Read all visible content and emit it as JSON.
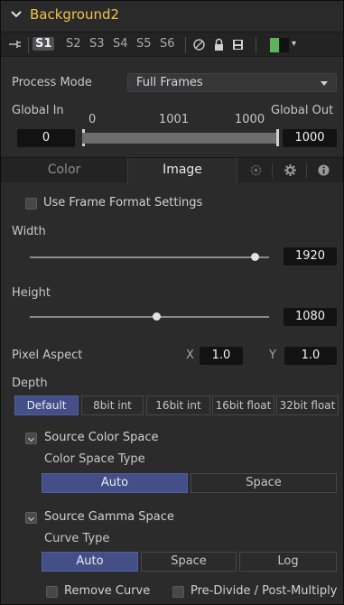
{
  "header": {
    "title": "Background2"
  },
  "toolbar": {
    "slots": [
      "S1",
      "S2",
      "S3",
      "S4",
      "S5",
      "S6"
    ],
    "active_slot": "S1",
    "swatch_colors": [
      "#5bb35b",
      "#111111"
    ]
  },
  "process_mode": {
    "label": "Process Mode",
    "value": "Full Frames"
  },
  "global": {
    "in_label": "Global In",
    "out_label": "Global Out",
    "range_min": "0",
    "range_mid": "1001",
    "range_max": "1000",
    "in_value": "0",
    "out_value": "1000"
  },
  "tabs": [
    {
      "label": "Color",
      "active": false
    },
    {
      "label": "Image",
      "active": true
    }
  ],
  "frame_format": {
    "label": "Use Frame Format Settings",
    "checked": false
  },
  "width": {
    "label": "Width",
    "value": "1920",
    "fraction": 0.94
  },
  "height": {
    "label": "Height",
    "value": "1080",
    "fraction": 0.53
  },
  "pixel_aspect": {
    "label": "Pixel Aspect",
    "x_label": "X",
    "x_value": "1.0",
    "y_label": "Y",
    "y_value": "1.0"
  },
  "depth": {
    "label": "Depth",
    "options": [
      "Default",
      "8bit int",
      "16bit int",
      "16bit float",
      "32bit float"
    ],
    "selected": "Default"
  },
  "source_color_space": {
    "section_label": "Source Color Space",
    "type_label": "Color Space Type",
    "options": [
      "Auto",
      "Space"
    ],
    "selected": "Auto"
  },
  "source_gamma_space": {
    "section_label": "Source Gamma Space",
    "curve_label": "Curve Type",
    "options": [
      "Auto",
      "Space",
      "Log"
    ],
    "selected": "Auto"
  },
  "footer": {
    "remove_curve": "Remove Curve",
    "pre_divide": "Pre-Divide / Post-Multiply"
  },
  "colors": {
    "accent": "#434f86",
    "title": "#f1c24a"
  }
}
